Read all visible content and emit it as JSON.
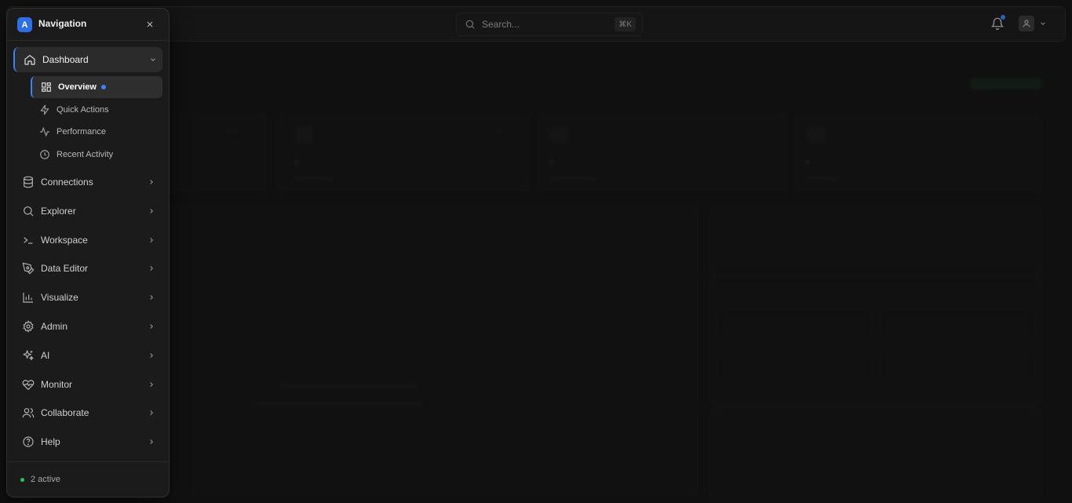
{
  "header": {
    "search_placeholder": "Search...",
    "search_shortcut": "⌘K"
  },
  "navigation": {
    "logo_letter": "A",
    "title": "Navigation",
    "items": [
      {
        "label": "Dashboard",
        "icon": "home-icon",
        "expanded": true
      },
      {
        "label": "Connections",
        "icon": "database-icon"
      },
      {
        "label": "Explorer",
        "icon": "search-icon"
      },
      {
        "label": "Workspace",
        "icon": "terminal-icon"
      },
      {
        "label": "Data Editor",
        "icon": "pen-tool-icon"
      },
      {
        "label": "Visualize",
        "icon": "bar-chart-icon"
      },
      {
        "label": "Admin",
        "icon": "gear-icon"
      },
      {
        "label": "AI",
        "icon": "sparkles-icon"
      },
      {
        "label": "Monitor",
        "icon": "heart-pulse-icon"
      },
      {
        "label": "Collaborate",
        "icon": "users-icon"
      },
      {
        "label": "Help",
        "icon": "help-circle-icon"
      }
    ],
    "dashboard_sub": [
      {
        "label": "Overview",
        "icon": "layout-grid-icon",
        "active": true
      },
      {
        "label": "Quick Actions",
        "icon": "zap-icon"
      },
      {
        "label": "Performance",
        "icon": "activity-icon"
      },
      {
        "label": "Recent Activity",
        "icon": "clock-icon"
      }
    ],
    "footer_status": "2 active"
  },
  "colors": {
    "accent": "#3b82f6",
    "success": "#22c55e",
    "panel_bg": "#1b1b1b"
  }
}
